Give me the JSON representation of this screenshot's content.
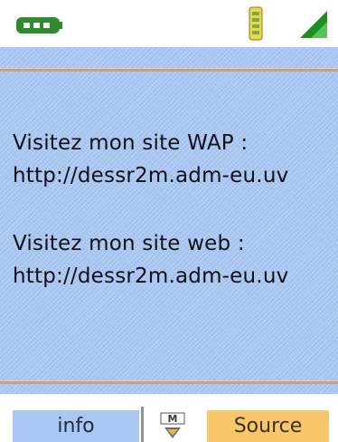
{
  "status": {
    "battery_icon": "battery-icon",
    "signal_icon": "signal-strength-icon",
    "network_icon": "network-icon",
    "battery_color": "#2e8b2e",
    "signal_color": "#d8c020",
    "network_color": "#1e8f1e"
  },
  "content": {
    "lines": [
      "Visitez mon site WAP :",
      "http://dessr2m.adm-eu.uv",
      "Visitez mon site web :",
      "http://dessr2m.adm-eu.uv"
    ],
    "background_color": "#a9c7f2"
  },
  "softkeys": {
    "left_label": "info",
    "menu_icon": "menu-icon",
    "right_label": "Source"
  }
}
